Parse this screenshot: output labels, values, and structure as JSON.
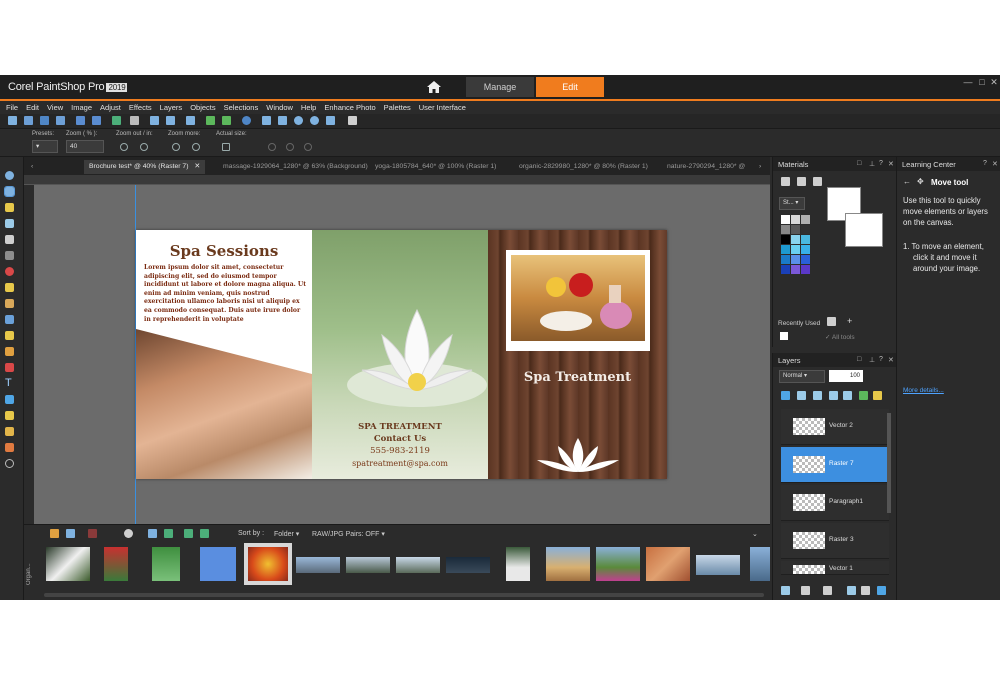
{
  "app": {
    "name": "Corel PaintShop Pro",
    "year": "2019",
    "workspace_tabs": [
      "Manage",
      "Edit"
    ],
    "active_workspace": "Edit",
    "accent_color": "#f07c1e"
  },
  "menu": [
    "File",
    "Edit",
    "View",
    "Image",
    "Adjust",
    "Effects",
    "Layers",
    "Objects",
    "Selections",
    "Window",
    "Help",
    "Enhance Photo",
    "Palettes",
    "User Interface"
  ],
  "tool_options": {
    "presets_label": "Presets:",
    "zoom_label": "Zoom ( % ):",
    "zoom_value": "40",
    "zoom_out_label": "Zoom out / in:",
    "zoom_more_label": "Zoom more:",
    "actual_size_label": "Actual size:"
  },
  "doc_tabs": [
    "Brochure test* @  40% (Raster 7)",
    "massage-1929064_1280* @  63% (Background)",
    "yoga-1805784_640* @ 100% (Raster 1)",
    "organic-2829980_1280* @  80% (Raster 1)",
    "nature-2790294_1280* @"
  ],
  "brochure": {
    "heading": "Spa Sessions",
    "body": "Lorem ipsum dolor sit amet, consectetur adipiscing elit, sed do eiusmod tempor incididunt ut labore et dolore magna aliqua. Ut enim ad minim veniam, quis nostrud exercitation ullamco laboris nisi ut aliquip ex ea commodo consequat. Duis aute irure dolor in reprehenderit in voluptate",
    "middle_title": "SPA TREATMENT",
    "middle_contact": "Contact Us",
    "phone": "555-983-2119",
    "email": "spatreatment@spa.com",
    "right_title": "Spa Treatment"
  },
  "organizer": {
    "label": "Organ...",
    "sort_label": "Sort by :",
    "sort_value": "Folder",
    "raw_pairs": "RAW/JPG Pairs: OFF"
  },
  "materials": {
    "title": "Materials",
    "style_label": "St...",
    "all_tools": "All tools",
    "recently_used": "Recently Used"
  },
  "layers": {
    "title": "Layers",
    "blend_mode": "Normal",
    "opacity": "100",
    "items": [
      {
        "name": "Vector 2",
        "selected": false
      },
      {
        "name": "Raster 7",
        "selected": true
      },
      {
        "name": "Paragraph1",
        "selected": false
      },
      {
        "name": "Raster 3",
        "selected": false
      },
      {
        "name": "Vector 1",
        "selected": false
      }
    ]
  },
  "learning": {
    "title": "Learning Center",
    "tool": "Move tool",
    "description": "Use this tool to quickly move elements or layers on the canvas.",
    "step": "1. To move an element, click it and move it around your image.",
    "link": "More details..."
  }
}
